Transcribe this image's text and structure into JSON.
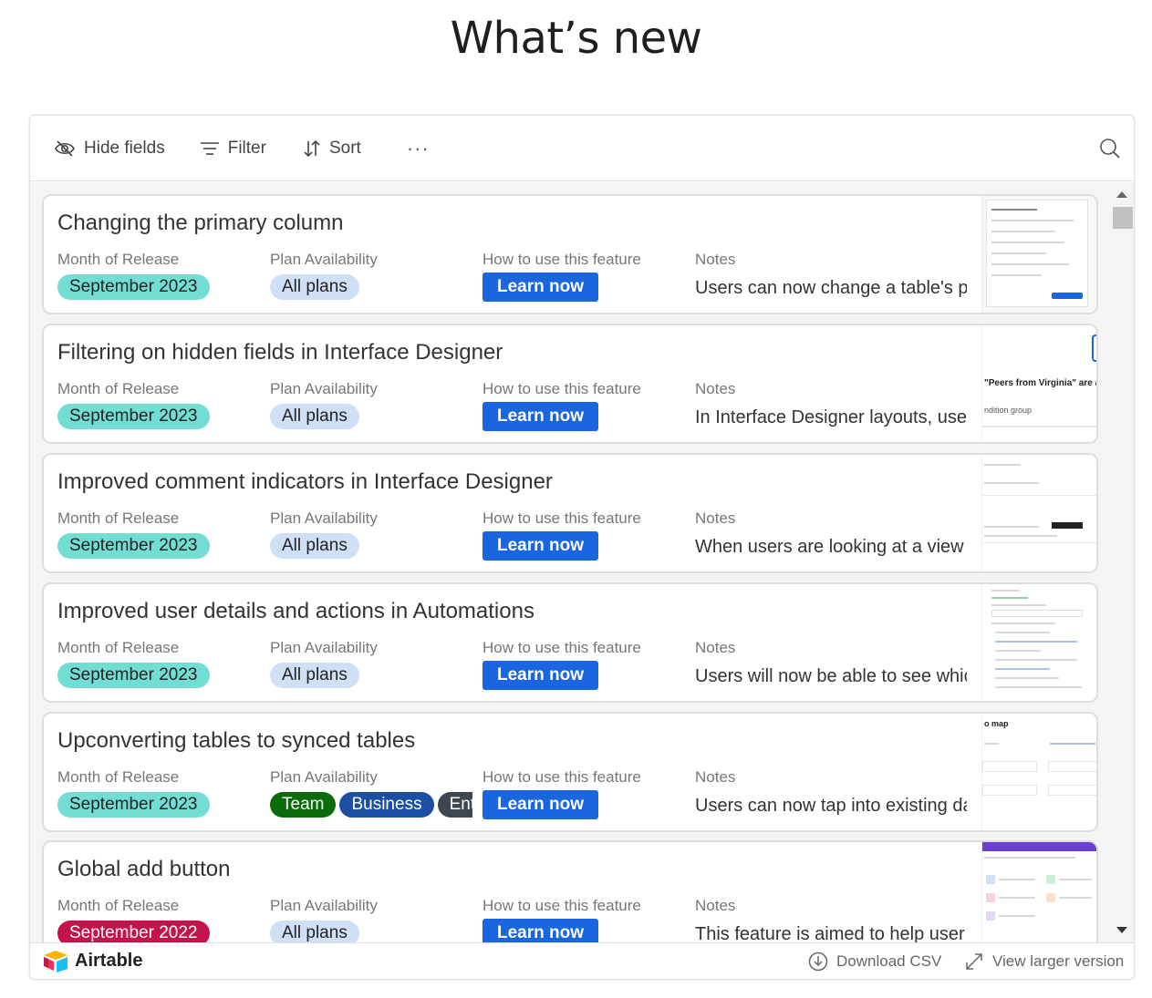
{
  "page_title": "What’s new",
  "toolbar": {
    "hide_fields": "Hide fields",
    "filter": "Filter",
    "sort": "Sort",
    "more": "···"
  },
  "field_labels": {
    "month": "Month of Release",
    "plan": "Plan Availability",
    "howto": "How to use this feature",
    "notes": "Notes"
  },
  "records": [
    {
      "title": "Changing the primary column",
      "month": "September 2023",
      "plans": [
        "All plans"
      ],
      "button": "Learn now",
      "notes": "Users can now change a table's p"
    },
    {
      "title": "Filtering on hidden fields in Interface Designer",
      "month": "September 2023",
      "plans": [
        "All plans"
      ],
      "button": "Learn now",
      "notes": "In Interface Designer layouts, user",
      "thumb_text": [
        "\"Peers from Virginia\" are ac",
        "ndition group"
      ]
    },
    {
      "title": "Improved comment indicators in Interface Designer",
      "month": "September 2023",
      "plans": [
        "All plans"
      ],
      "button": "Learn now",
      "notes": "When users are looking at a view"
    },
    {
      "title": "Improved user details and actions in Automations",
      "month": "September 2023",
      "plans": [
        "All plans"
      ],
      "button": "Learn now",
      "notes": "Users will now be able to see whic"
    },
    {
      "title": "Upconverting tables to synced tables",
      "month": "September 2023",
      "plans": [
        "Team",
        "Business",
        "Enterprise"
      ],
      "button": "Learn now",
      "notes": "Users can now tap into existing da",
      "thumb_text": [
        "o map"
      ]
    },
    {
      "title": "Global add button",
      "month": "September 2022",
      "plans": [
        "All plans"
      ],
      "button": "Learn now",
      "notes": "This feature is aimed to help user"
    }
  ],
  "footer": {
    "brand": "Airtable",
    "download": "Download CSV",
    "larger": "View larger version"
  },
  "colors": {
    "month_pill": "#72ddd3",
    "month_pill_2022": "#c5134a",
    "plan_pill": "#cfdff5",
    "team": "#0a6b0a",
    "business": "#1c4fa3",
    "enterprise": "#3d4651",
    "button": "#1966e0"
  }
}
